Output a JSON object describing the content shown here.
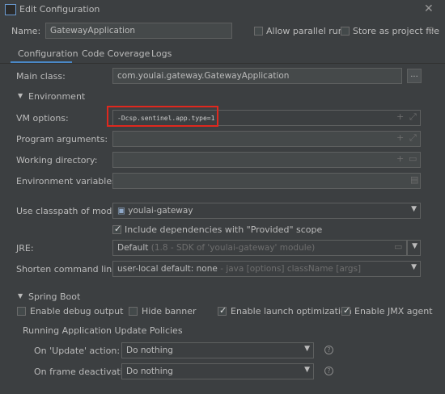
{
  "window": {
    "title": "Edit Configuration"
  },
  "header": {
    "name_label": "Name:",
    "name_value": "GatewayApplication",
    "allow_parallel_run": "Allow parallel run",
    "store_as_project_file": "Store as project file"
  },
  "tabs": [
    {
      "label": "Configuration",
      "active": true
    },
    {
      "label": "Code Coverage"
    },
    {
      "label": "Logs"
    }
  ],
  "config": {
    "main_class_label": "Main class:",
    "main_class_value": "com.youlai.gateway.GatewayApplication",
    "browse_label": "...",
    "environment_section": "Environment",
    "vm_options_label": "VM options:",
    "vm_options_value": "-Dcsp.sentinel.app.type=1",
    "program_arguments_label": "Program arguments:",
    "working_directory_label": "Working directory:",
    "environment_variables_label": "Environment variables:",
    "classpath_label": "Use classpath of module:",
    "classpath_value": "youlai-gateway",
    "include_dependencies": "Include dependencies with \"Provided\" scope",
    "jre_label": "JRE:",
    "jre_default": "Default",
    "jre_detail": "(1.8 - SDK of 'youlai-gateway' module)",
    "shorten_label": "Shorten command line:",
    "shorten_value": "user-local default: none",
    "shorten_detail": "- java [options] className [args]"
  },
  "spring_boot": {
    "section": "Spring Boot",
    "enable_debug_output": "Enable debug output",
    "hide_banner": "Hide banner",
    "enable_launch_optimization": "Enable launch optimization",
    "enable_jmx_agent": "Enable JMX agent",
    "update_policies_title": "Running Application Update Policies",
    "on_update_label": "On 'Update' action:",
    "on_update_value": "Do nothing",
    "on_frame_label": "On frame deactivation:",
    "on_frame_value": "Do nothing",
    "help_glyph": "?"
  }
}
